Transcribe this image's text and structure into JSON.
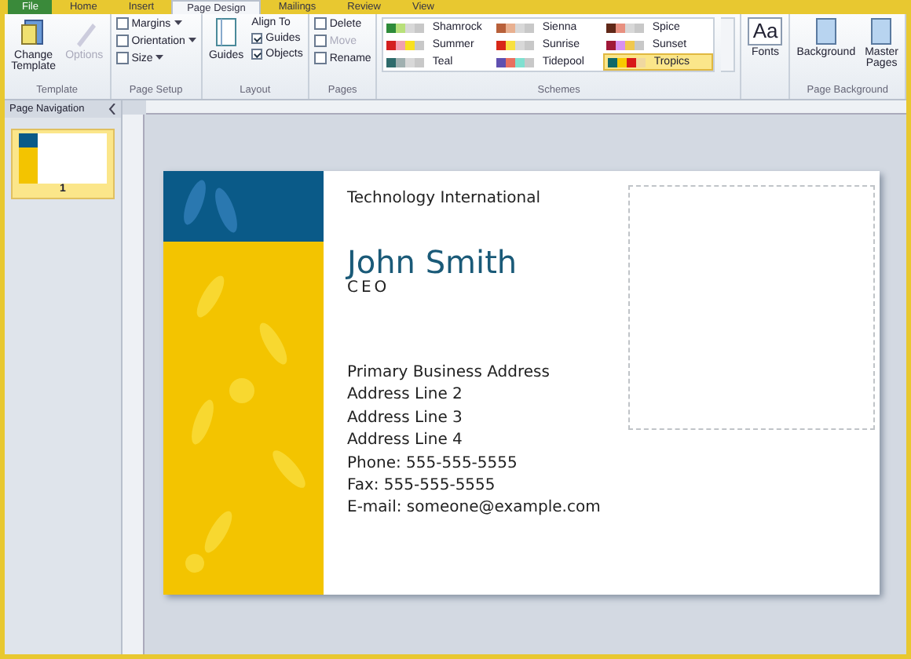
{
  "tabs": [
    {
      "label": "File",
      "selected": false,
      "kind": "file"
    },
    {
      "label": "Home",
      "selected": false,
      "kind": "tab"
    },
    {
      "label": "Insert",
      "selected": false,
      "kind": "tab"
    },
    {
      "label": "Page Design",
      "selected": true,
      "kind": "tab"
    },
    {
      "label": "Mailings",
      "selected": false,
      "kind": "tab"
    },
    {
      "label": "Review",
      "selected": false,
      "kind": "tab"
    },
    {
      "label": "View",
      "selected": false,
      "kind": "tab"
    }
  ],
  "ribbon": {
    "template": {
      "label": "Template",
      "buttons": [
        {
          "label": "Change Template",
          "disabled": false
        },
        {
          "label": "Options",
          "disabled": true
        }
      ]
    },
    "page_setup": {
      "label": "Page Setup",
      "items": [
        "Margins",
        "Orientation",
        "Size"
      ]
    },
    "layout": {
      "label": "Layout",
      "guides": "Guides",
      "align_to": "Align To",
      "checks": [
        {
          "label": "Guides",
          "checked": true
        },
        {
          "label": "Objects",
          "checked": true
        }
      ]
    },
    "pages": {
      "label": "Pages",
      "items": [
        {
          "label": "Delete",
          "disabled": false
        },
        {
          "label": "Move",
          "disabled": true
        },
        {
          "label": "Rename",
          "disabled": false
        }
      ]
    },
    "schemes": {
      "label": "Schemes",
      "items": [
        {
          "name": "Shamrock",
          "selected": false,
          "swatches": [
            {
              "color": "#2e8b3a"
            },
            {
              "color": "#b8e07a"
            },
            {
              "color": "#d8d8d8"
            },
            {
              "color": "#c8c8c8"
            }
          ]
        },
        {
          "name": "Summer",
          "selected": false,
          "swatches": [
            {
              "color": "#d42020"
            },
            {
              "color": "#f0a0b0"
            },
            {
              "color": "#f8e020"
            },
            {
              "color": "#c8c8c8"
            }
          ]
        },
        {
          "name": "Teal",
          "selected": false,
          "swatches": [
            {
              "color": "#2e6b6b"
            },
            {
              "color": "#a0b0b0"
            },
            {
              "color": "#d8d8d8"
            },
            {
              "color": "#c8c8c8"
            }
          ]
        },
        {
          "name": "Sienna",
          "selected": false,
          "swatches": [
            {
              "color": "#b8603a"
            },
            {
              "color": "#e8b090"
            },
            {
              "color": "#d8d8d8"
            },
            {
              "color": "#c8c8c8"
            }
          ]
        },
        {
          "name": "Sunrise",
          "selected": false,
          "swatches": [
            {
              "color": "#d82818"
            },
            {
              "color": "#f8e040"
            },
            {
              "color": "#d8d8d8"
            },
            {
              "color": "#c8c8c8"
            }
          ]
        },
        {
          "name": "Tidepool",
          "selected": false,
          "swatches": [
            {
              "color": "#6050b0"
            },
            {
              "color": "#e87060"
            },
            {
              "color": "#80e0d0"
            },
            {
              "color": "#c8c8c8"
            }
          ]
        },
        {
          "name": "Spice",
          "selected": false,
          "swatches": [
            {
              "color": "#602818"
            },
            {
              "color": "#e89080"
            },
            {
              "color": "#d8d8d8"
            },
            {
              "color": "#c8c8c8"
            }
          ]
        },
        {
          "name": "Sunset",
          "selected": false,
          "swatches": [
            {
              "color": "#a01838"
            },
            {
              "color": "#d890f0"
            },
            {
              "color": "#f0c850"
            },
            {
              "color": "#c8c8c8"
            }
          ]
        },
        {
          "name": "Tropics",
          "selected": true,
          "swatches": [
            {
              "color": "#106868"
            },
            {
              "color": "#f8c800"
            },
            {
              "color": "#d81818"
            },
            {
              "color": "#f0d8a0"
            }
          ]
        }
      ]
    },
    "fonts": {
      "glyph": "Aa",
      "label": "Fonts"
    },
    "page_background": {
      "label": "Page Background",
      "buttons": [
        "Background",
        "Master Pages"
      ]
    }
  },
  "navigation": {
    "title": "Page Navigation",
    "pages": [
      {
        "number": "1",
        "selected": true
      }
    ]
  },
  "card": {
    "company": "Technology International",
    "name": "John Smith",
    "title": "CEO",
    "lines": [
      "Primary Business Address",
      "Address Line 2",
      "Address Line 3",
      "Address Line 4",
      "Phone: 555-555-5555",
      "Fax: 555-555-5555",
      "E-mail: someone@example.com"
    ]
  }
}
